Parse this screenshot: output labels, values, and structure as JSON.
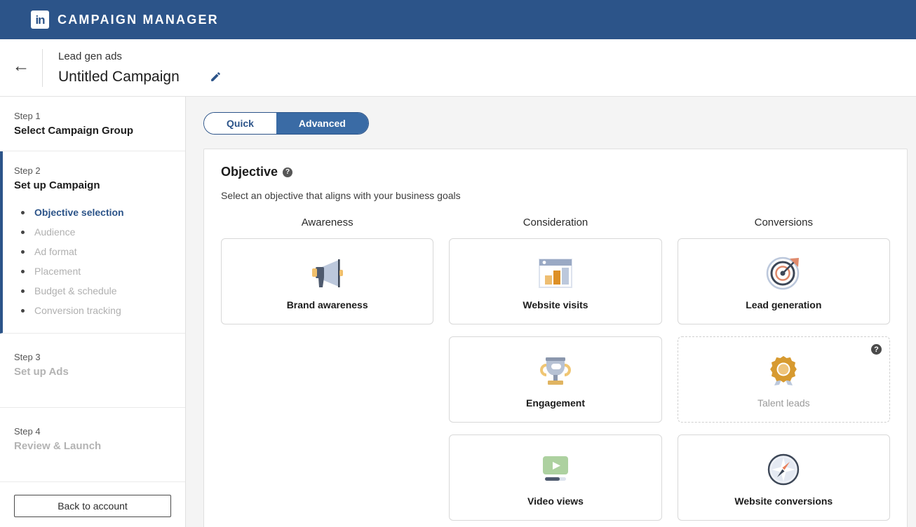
{
  "topbar": {
    "logo_text": "in",
    "brand": "CAMPAIGN MANAGER"
  },
  "subheader": {
    "back_icon": "arrow-left-icon",
    "kicker": "Lead gen ads",
    "campaign_name": "Untitled Campaign",
    "edit_icon": "pencil-icon"
  },
  "sidebar": {
    "steps": [
      {
        "num": "Step 1",
        "title": "Select Campaign Group",
        "dim": false
      },
      {
        "num": "Step 2",
        "title": "Set up Campaign",
        "dim": false
      },
      {
        "num": "Step 3",
        "title": "Set up Ads",
        "dim": true
      },
      {
        "num": "Step 4",
        "title": "Review & Launch",
        "dim": true
      }
    ],
    "substeps": [
      "Objective selection",
      "Audience",
      "Ad format",
      "Placement",
      "Budget & schedule",
      "Conversion tracking"
    ],
    "back_to_account": "Back to account"
  },
  "toggle": {
    "quick": "Quick",
    "advanced": "Advanced",
    "selected": "Advanced"
  },
  "objective": {
    "title": "Objective",
    "help_icon": "question-mark-icon",
    "subtitle": "Select an objective that aligns with your business goals",
    "columns": [
      {
        "heading": "Awareness"
      },
      {
        "heading": "Consideration"
      },
      {
        "heading": "Conversions"
      }
    ],
    "awareness_cards": [
      {
        "label": "Brand awareness",
        "icon": "megaphone-icon",
        "disabled": false
      }
    ],
    "consideration_cards": [
      {
        "label": "Website visits",
        "icon": "browser-bar-chart-icon",
        "disabled": false
      },
      {
        "label": "Engagement",
        "icon": "trophy-icon",
        "disabled": false
      },
      {
        "label": "Video views",
        "icon": "video-player-icon",
        "disabled": false
      }
    ],
    "conversions_cards": [
      {
        "label": "Lead generation",
        "icon": "target-arrow-icon",
        "disabled": false
      },
      {
        "label": "Talent leads",
        "icon": "award-rosette-icon",
        "disabled": true,
        "help_icon": "question-mark-icon"
      },
      {
        "label": "Website conversions",
        "icon": "compass-icon",
        "disabled": false
      }
    ]
  },
  "colors": {
    "brand_blue": "#2c5489",
    "toggle_active": "#3a6ba5",
    "link_blue": "#2c5489",
    "disabled_gray": "#b0b0b0",
    "page_bg": "#f4f4f4"
  }
}
